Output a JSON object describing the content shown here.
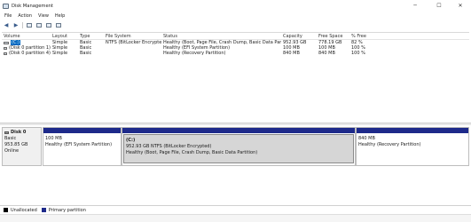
{
  "window": {
    "title": "Disk Management",
    "minimize_glyph": "─",
    "maximize_glyph": "☐",
    "close_glyph": "✕"
  },
  "menu": [
    "File",
    "Action",
    "View",
    "Help"
  ],
  "toolbar": {
    "back_glyph": "◀",
    "forward_glyph": "▶",
    "icons": [
      "back-icon",
      "forward-icon",
      "console-tree-icon",
      "help-icon",
      "properties-icon",
      "list-view-icon"
    ]
  },
  "volume_table": {
    "columns": [
      "Volume",
      "Layout",
      "Type",
      "File System",
      "Status",
      "Capacity",
      "Free Space",
      "% Free"
    ],
    "rows": [
      [
        "(C:)",
        "Simple",
        "Basic",
        "NTFS (BitLocker Encrypted)",
        "Healthy (Boot, Page File, Crash Dump, Basic Data Partition)",
        "952.93 GB",
        "778.19 GB",
        "82 %"
      ],
      [
        "(Disk 0 partition 1)",
        "Simple",
        "Basic",
        "",
        "Healthy (EFI System Partition)",
        "100 MB",
        "100 MB",
        "100 %"
      ],
      [
        "(Disk 0 partition 4)",
        "Simple",
        "Basic",
        "",
        "Healthy (Recovery Partition)",
        "840 MB",
        "840 MB",
        "100 %"
      ]
    ]
  },
  "disk": {
    "name": "Disk 0",
    "type": "Basic",
    "size": "953.85 GB",
    "status": "Online",
    "partitions": [
      {
        "title": "",
        "size": "100 MB",
        "status": "Healthy (EFI System Partition)"
      },
      {
        "title": "(C:)",
        "size": "952.93 GB NTFS (BitLocker Encrypted)",
        "status": "Healthy (Boot, Page File, Crash Dump, Basic Data Partition)"
      },
      {
        "title": "",
        "size": "840 MB",
        "status": "Healthy (Recovery Partition)"
      }
    ]
  },
  "legend": [
    {
      "label": "Unallocated",
      "color": "#000000"
    },
    {
      "label": "Primary partition",
      "color": "#1e2a8a"
    }
  ]
}
